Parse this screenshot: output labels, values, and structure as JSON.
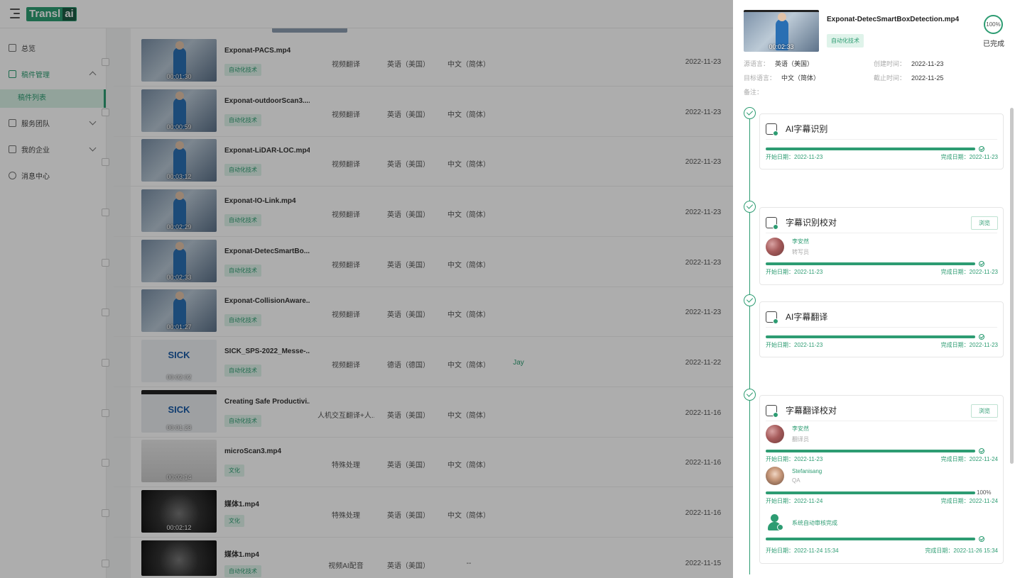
{
  "app": {
    "logo_left": "Transl",
    "logo_right": "ai"
  },
  "sidebar": {
    "items": [
      {
        "label": "总览"
      },
      {
        "label": "稿件管理"
      },
      {
        "label": "服务团队"
      },
      {
        "label": "我的企业"
      },
      {
        "label": "消息中心"
      }
    ],
    "sub_item": "稿件列表"
  },
  "rows": [
    {
      "name": "Exponat-PACS.mp4",
      "duration": "00:01:30",
      "tag": "自动化技术",
      "type": "视频翻译",
      "source": "英语（美国）",
      "target": "中文（简体）",
      "assignee": "",
      "date": "2022-11-23"
    },
    {
      "name": "Exponat-outdoorScan3....",
      "duration": "00:00:59",
      "tag": "自动化技术",
      "type": "视频翻译",
      "source": "英语（美国）",
      "target": "中文（简体）",
      "assignee": "",
      "date": "2022-11-23"
    },
    {
      "name": "Exponat-LiDAR-LOC.mp4",
      "duration": "00:03:12",
      "tag": "自动化技术",
      "type": "视频翻译",
      "source": "英语（美国）",
      "target": "中文（简体）",
      "assignee": "",
      "date": "2022-11-23"
    },
    {
      "name": "Exponat-IO-Link.mp4",
      "duration": "00:02:29",
      "tag": "自动化技术",
      "type": "视频翻译",
      "source": "英语（美国）",
      "target": "中文（简体）",
      "assignee": "",
      "date": "2022-11-23"
    },
    {
      "name": "Exponat-DetecSmartBo...",
      "duration": "00:02:33",
      "tag": "自动化技术",
      "type": "视频翻译",
      "source": "英语（美国）",
      "target": "中文（简体）",
      "assignee": "",
      "date": "2022-11-23"
    },
    {
      "name": "Exponat-CollisionAware...",
      "duration": "00:01:27",
      "tag": "自动化技术",
      "type": "视频翻译",
      "source": "英语（美国）",
      "target": "中文（简体）",
      "assignee": "",
      "date": "2022-11-23"
    },
    {
      "name": "SICK_SPS-2022_Messe-...",
      "duration": "00:02:02",
      "tag": "自动化技术",
      "type": "视频翻译",
      "source": "德语（德国）",
      "target": "中文（简体）",
      "assignee": "Jay",
      "date": "2022-11-22",
      "thumb": "SICK"
    },
    {
      "name": "Creating Safe Productivi...",
      "duration": "00:01:23",
      "tag": "自动化技术",
      "type": "人机交互翻译+人...",
      "source": "英语（美国）",
      "target": "中文（简体）",
      "assignee": "",
      "date": "2022-11-16",
      "thumb": "SICK"
    },
    {
      "name": "microScan3.mp4",
      "duration": "00:02:14",
      "tag": "文化",
      "type": "特殊处理",
      "source": "英语（美国）",
      "target": "中文（简体）",
      "assignee": "",
      "date": "2022-11-16"
    },
    {
      "name": "媒体1.mp4",
      "duration": "00:02:12",
      "tag": "文化",
      "type": "特殊处理",
      "source": "英语（美国）",
      "target": "中文（简体）",
      "assignee": "",
      "date": "2022-11-16"
    },
    {
      "name": "媒体1.mp4",
      "duration": "",
      "tag": "自动化技术",
      "type": "视频AI配音",
      "source": "英语（美国）",
      "target": "--",
      "assignee": "",
      "date": "2022-11-15"
    }
  ],
  "drawer": {
    "file_name": "Exponat-DetecSmartBoxDetection.mp4",
    "duration": "00:02:33",
    "tag": "自动化技术",
    "progress_text": "100%",
    "progress": 1.0,
    "status": "已完成",
    "meta": {
      "source_lang_label": "源语言：",
      "source_lang": "英语（美国）",
      "target_lang_label": "目标语言：",
      "target_lang": "中文（简体）",
      "created_label": "创建时间：",
      "created": "2022-11-23",
      "deadline_label": "截止时间：",
      "deadline": "2022-11-25",
      "note_label": "备注："
    },
    "start_label": "开始日期：",
    "end_label": "完成日期：",
    "steps": [
      {
        "title": "AI字幕识别",
        "progress": 1.0,
        "start": "2022-11-23",
        "end": "2022-11-23"
      },
      {
        "title": "字幕识别校对",
        "button": "浏览",
        "person": {
          "name": "李安然",
          "role": "转写员"
        },
        "progress": 1.0,
        "start": "2022-11-23",
        "end": "2022-11-23"
      },
      {
        "title": "AI字幕翻译",
        "progress": 1.0,
        "start": "2022-11-23",
        "end": "2022-11-23"
      },
      {
        "title": "字幕翻译校对",
        "button": "浏览",
        "tasks": [
          {
            "name": "李安然",
            "role": "翻译员",
            "progress": 1.0,
            "start": "2022-11-23",
            "end": "2022-11-24"
          },
          {
            "name": "Stefanisang",
            "role": "QA",
            "progress": 1.0,
            "progress_text": "100%",
            "start": "2022-11-24",
            "end": "2022-11-24"
          },
          {
            "name": "系统自动审核完成",
            "progress": 1.0,
            "start": "2022-11-24 15:34",
            "end": "2022-11-26 15:34"
          }
        ]
      }
    ]
  },
  "colors": {
    "accent": "#2d9c72",
    "tag_bg": "#dff3ea"
  }
}
